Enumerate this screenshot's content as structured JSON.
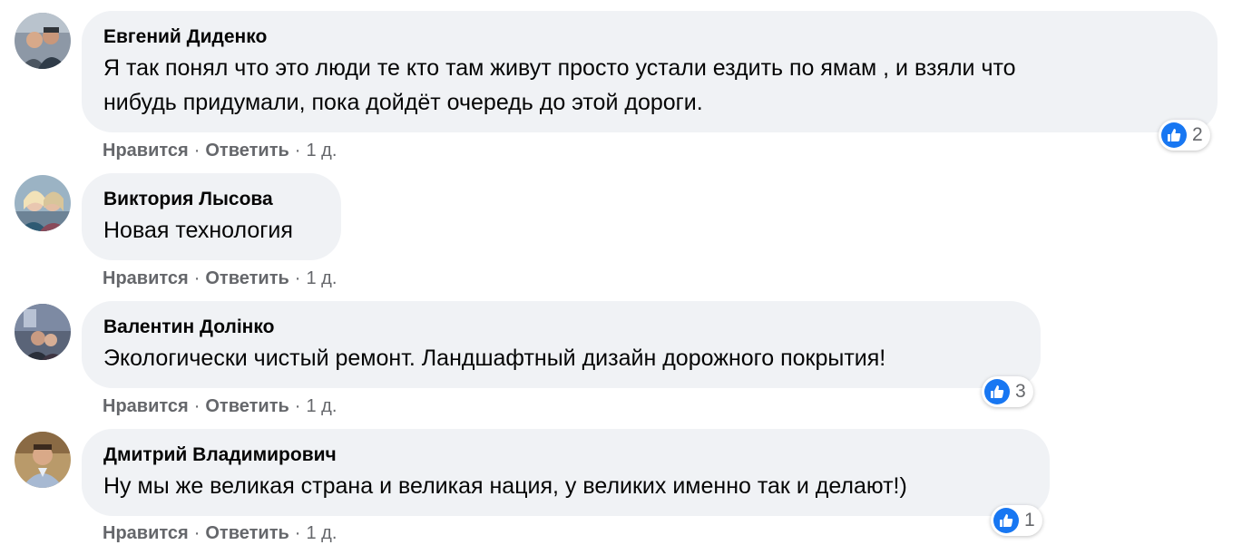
{
  "comments": [
    {
      "author": "Евгений Диденко",
      "text_lines": [
        "Я так понял что это люди те кто там живут просто устали ездить по ямам , и взяли что",
        "нибудь придумали, пока дойдёт очередь до этой дороги."
      ],
      "like_label": "Нравится",
      "reply_label": "Ответить",
      "time": "1 д.",
      "reaction_icon": "like-icon",
      "reaction_count": "2"
    },
    {
      "author": "Виктория Лысова",
      "text_lines": [
        "Новая технология"
      ],
      "like_label": "Нравится",
      "reply_label": "Ответить",
      "time": "1 д."
    },
    {
      "author": "Валентин Долінко",
      "text_lines": [
        "Экологически чистый ремонт. Ландшафтный дизайн дорожного покрытия!"
      ],
      "like_label": "Нравится",
      "reply_label": "Ответить",
      "time": "1 д.",
      "reaction_icon": "like-icon",
      "reaction_count": "3"
    },
    {
      "author": "Дмитрий Владимирович",
      "text_lines": [
        "Ну мы же великая страна и великая нация, у великих именно так и делают!)"
      ],
      "like_label": "Нравится",
      "reply_label": "Ответить",
      "time": "1 д.",
      "reaction_icon": "like-icon",
      "reaction_count": "1"
    }
  ],
  "separator": "·",
  "colors": {
    "bubble_bg": "#f0f2f5",
    "like_blue": "#1877f2",
    "meta_gray": "#65676b",
    "text": "#050505"
  }
}
